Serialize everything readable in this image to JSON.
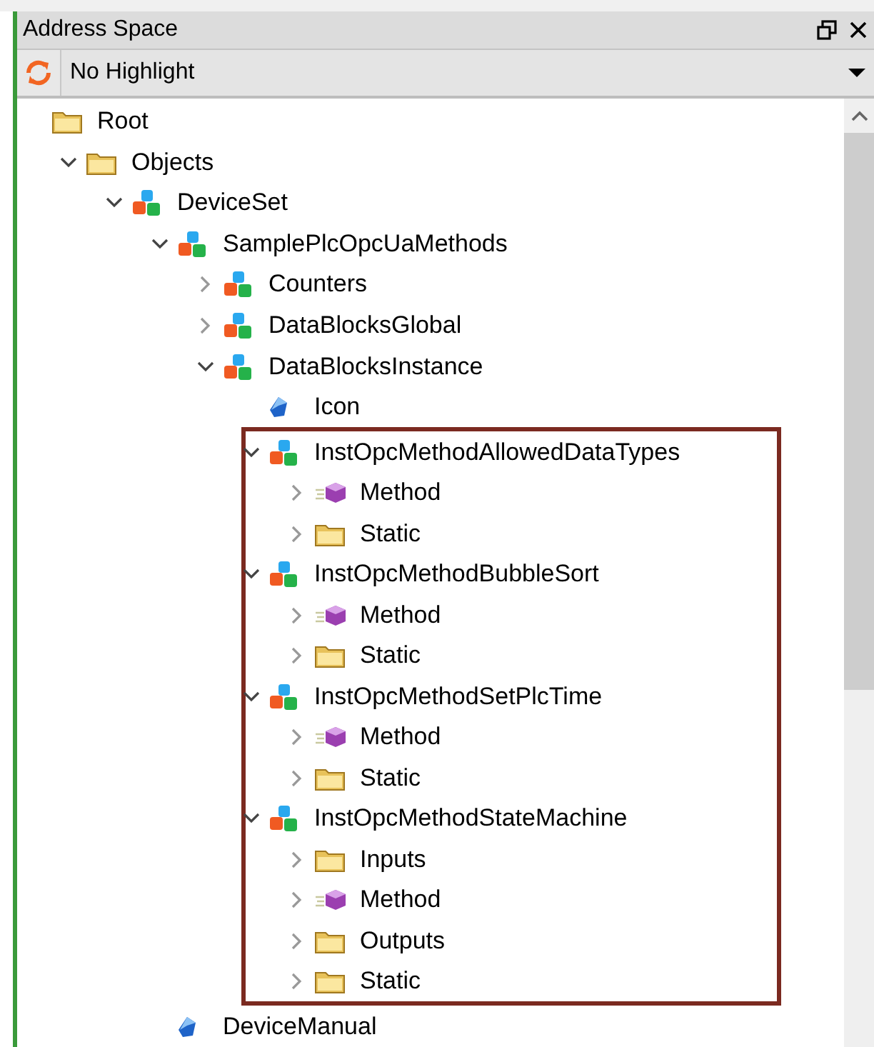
{
  "panel": {
    "title": "Address Space"
  },
  "toolbar": {
    "highlight_select": {
      "value": "No Highlight"
    }
  },
  "tree": [
    {
      "label": "Root",
      "kind": "folder",
      "children": [
        {
          "label": "Objects",
          "kind": "folder",
          "expanded": true,
          "children": [
            {
              "label": "DeviceSet",
              "kind": "object",
              "expanded": true,
              "children": [
                {
                  "label": "SamplePlcOpcUaMethods",
                  "kind": "object",
                  "expanded": true,
                  "children": [
                    {
                      "label": "Counters",
                      "kind": "object",
                      "expanded": false
                    },
                    {
                      "label": "DataBlocksGlobal",
                      "kind": "object",
                      "expanded": false
                    },
                    {
                      "label": "DataBlocksInstance",
                      "kind": "object",
                      "expanded": true,
                      "children": [
                        {
                          "label": "Icon",
                          "kind": "variable"
                        },
                        {
                          "label": "InstOpcMethodAllowedDataTypes",
                          "kind": "object",
                          "expanded": true,
                          "framed": true,
                          "children": [
                            {
                              "label": "Method",
                              "kind": "method",
                              "expanded": false
                            },
                            {
                              "label": "Static",
                              "kind": "folder",
                              "expanded": false
                            }
                          ]
                        },
                        {
                          "label": "InstOpcMethodBubbleSort",
                          "kind": "object",
                          "expanded": true,
                          "framed": true,
                          "children": [
                            {
                              "label": "Method",
                              "kind": "method",
                              "expanded": false
                            },
                            {
                              "label": "Static",
                              "kind": "folder",
                              "expanded": false
                            }
                          ]
                        },
                        {
                          "label": "InstOpcMethodSetPlcTime",
                          "kind": "object",
                          "expanded": true,
                          "framed": true,
                          "children": [
                            {
                              "label": "Method",
                              "kind": "method",
                              "expanded": false
                            },
                            {
                              "label": "Static",
                              "kind": "folder",
                              "expanded": false
                            }
                          ]
                        },
                        {
                          "label": "InstOpcMethodStateMachine",
                          "kind": "object",
                          "expanded": true,
                          "framed": true,
                          "children": [
                            {
                              "label": "Inputs",
                              "kind": "folder",
                              "expanded": false
                            },
                            {
                              "label": "Method",
                              "kind": "method",
                              "expanded": false
                            },
                            {
                              "label": "Outputs",
                              "kind": "folder",
                              "expanded": false
                            },
                            {
                              "label": "Static",
                              "kind": "folder",
                              "expanded": false
                            }
                          ]
                        }
                      ]
                    }
                  ]
                },
                {
                  "label": "DeviceManual",
                  "kind": "variable"
                }
              ]
            }
          ]
        }
      ]
    }
  ]
}
